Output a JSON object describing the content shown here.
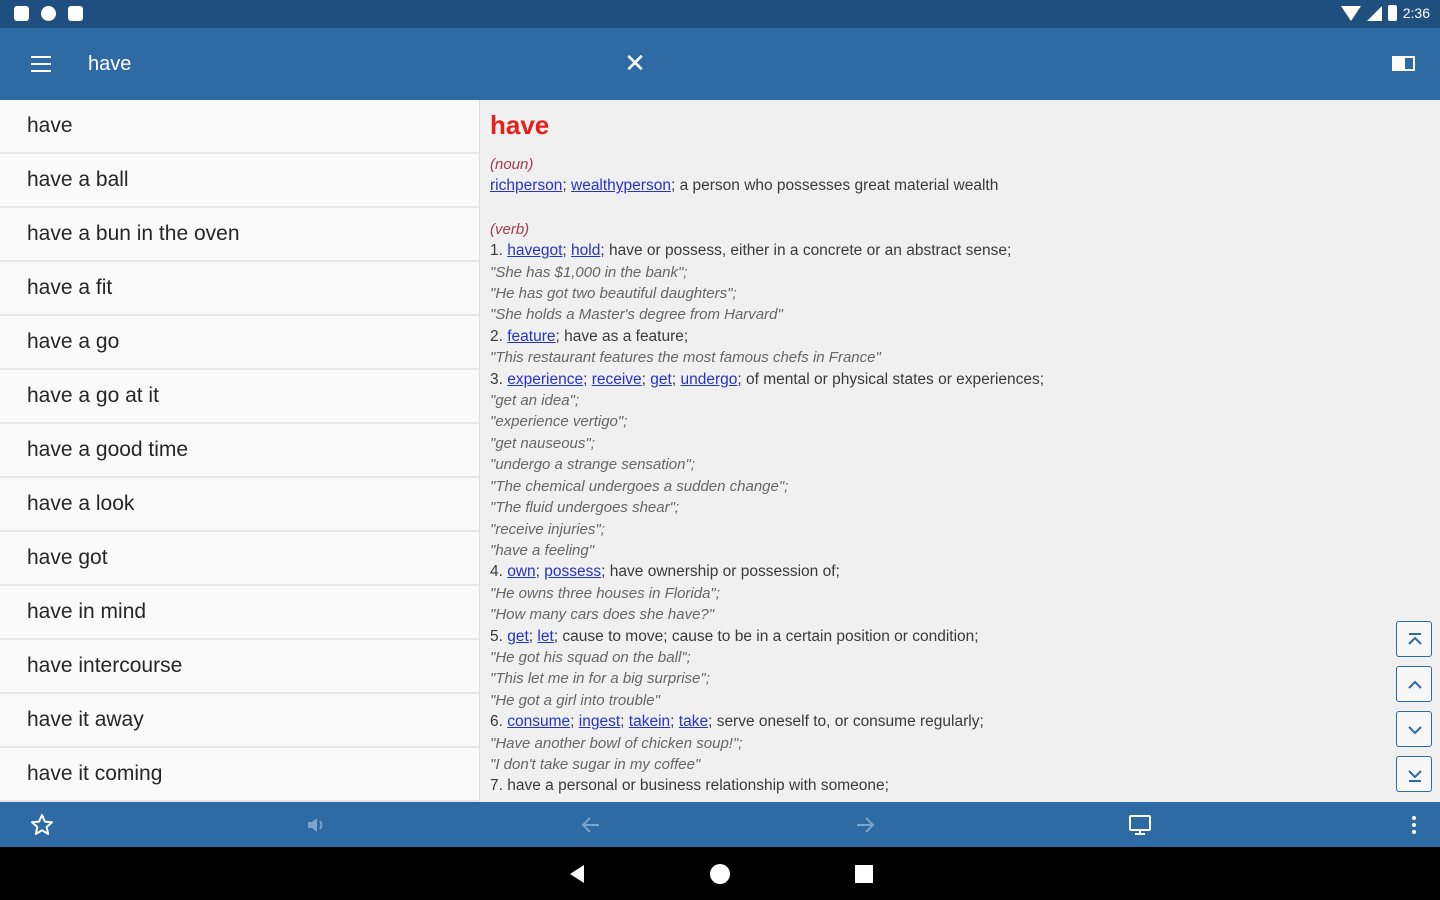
{
  "status_bar": {
    "time": "2:36"
  },
  "app_bar": {
    "search_value": "have",
    "clear_symbol": "✕"
  },
  "word_list": [
    "have",
    "have a ball",
    "have a bun in the oven",
    "have a fit",
    "have a go",
    "have a go at it",
    "have a good time",
    "have a look",
    "have got",
    "have in mind",
    "have intercourse",
    "have it away",
    "have it coming"
  ],
  "definition": {
    "headword": "have",
    "noun": {
      "label": "(noun)",
      "syn1": "richperson",
      "sep1": "; ",
      "syn2": "wealthyperson",
      "gloss": "; a person who possesses great material wealth"
    },
    "verb": {
      "label": "(verb)",
      "s1": {
        "num": "1. ",
        "syn1": "havegot",
        "syn2": "hold",
        "gloss": "; have or possess, either in a concrete or an abstract sense;",
        "ex": [
          "\"She has $1,000 in the bank\";",
          "\"He has got two beautiful daughters\";",
          "\"She holds a Master's degree from Harvard\""
        ]
      },
      "s2": {
        "num": "2. ",
        "syn1": "feature",
        "gloss": "; have as a feature;",
        "ex": [
          "\"This restaurant features the most famous chefs in France\""
        ]
      },
      "s3": {
        "num": "3. ",
        "syn1": "experience",
        "syn2": "receive",
        "syn3": "get",
        "syn4": "undergo",
        "gloss": "; of mental or physical states or experiences;",
        "ex": [
          "\"get an idea\";",
          "\"experience vertigo\";",
          "\"get nauseous\";",
          "\"undergo a strange sensation\";",
          "\"The chemical undergoes a sudden change\";",
          "\"The fluid undergoes shear\";",
          "\"receive injuries\";",
          "\"have a feeling\""
        ]
      },
      "s4": {
        "num": "4. ",
        "syn1": "own",
        "syn2": "possess",
        "gloss": "; have ownership or possession of;",
        "ex": [
          "\"He owns three houses in Florida\";",
          "\"How many cars does she have?\""
        ]
      },
      "s5": {
        "num": "5. ",
        "syn1": "get",
        "syn2": "let",
        "gloss": "; cause to move; cause to be in a certain position or condition;",
        "ex": [
          "\"He got his squad on the ball\";",
          "\"This let me in for a big surprise\";",
          "\"He got a girl into trouble\""
        ]
      },
      "s6": {
        "num": "6. ",
        "syn1": "consume",
        "syn2": "ingest",
        "syn3": "takein",
        "syn4": "take",
        "gloss": "; serve oneself to, or consume regularly;",
        "ex": [
          "\"Have another bowl of chicken soup!\";",
          "\"I don't take sugar in my coffee\""
        ]
      },
      "s7": {
        "text": "7. have a personal or business relationship with someone;"
      }
    }
  },
  "colors": {
    "app_bar": "#2e6aa4",
    "status_bar": "#1f4f7e",
    "headword": "#e3201b",
    "synonym_link": "#2433c9",
    "pos_label": "#a53a52"
  },
  "icons": {
    "menu": "menu-icon",
    "clear": "close-icon",
    "book": "book-icon",
    "favorite": "star-icon",
    "speak": "speaker-icon",
    "back": "arrow-left-icon",
    "forward": "arrow-right-icon",
    "display": "monitor-icon",
    "more": "more-vert-icon",
    "scroll_top": "scroll-top-icon",
    "scroll_up": "chevron-up-icon",
    "scroll_down": "chevron-down-icon",
    "scroll_bottom": "scroll-bottom-icon"
  }
}
